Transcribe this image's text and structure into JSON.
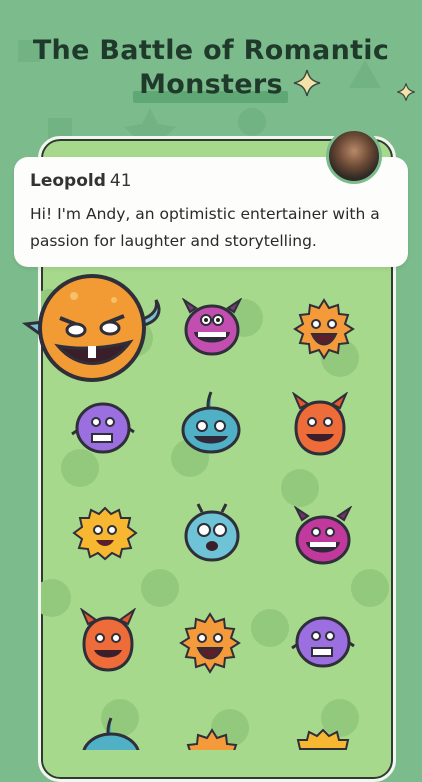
{
  "title": {
    "line1": "The Battle of Romantic",
    "line2": "Monsters"
  },
  "profile": {
    "name": "Leopold",
    "age": "41",
    "bio": "Hi! I'm Andy, an optimistic entertainer with a passion for laughter and storytelling."
  },
  "colors": {
    "background": "#7cbc8c",
    "board": "#a7d98c",
    "title": "#1f3a2b",
    "card": "#fdfdfb"
  },
  "monsters": [
    "orange-monster-selected",
    "purple-horned-monster",
    "orange-sun-monster",
    "purple-blob-monster",
    "teal-fish-monster",
    "orange-horned-monster",
    "yellow-fluffy-monster",
    "blue-antenna-monster",
    "magenta-horned-monster",
    "orange-horned-monster",
    "orange-sun-monster",
    "purple-blob-monster",
    "teal-fish-monster",
    "orange-sun-monster",
    "yellow-fluffy-monster"
  ]
}
